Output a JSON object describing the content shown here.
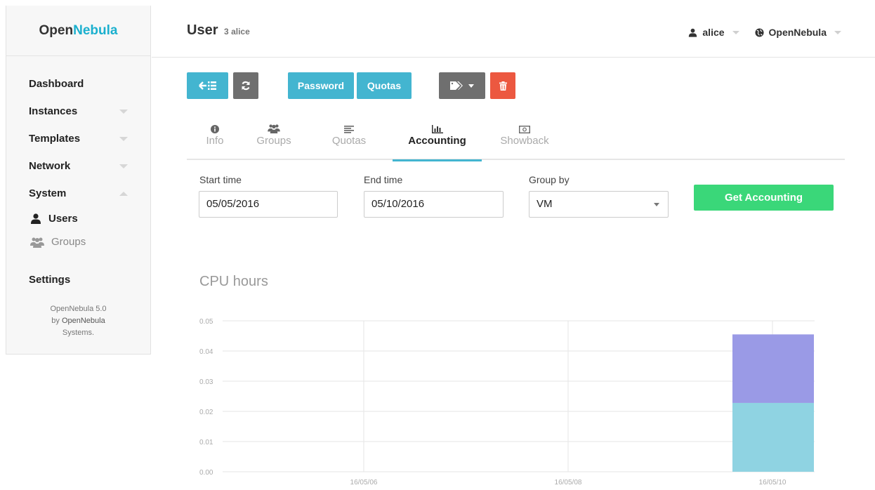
{
  "sidebar": {
    "logo_prefix": "Open",
    "logo_accent": "Nebula",
    "menu": [
      {
        "label": "Dashboard"
      },
      {
        "label": "Instances"
      },
      {
        "label": "Templates"
      },
      {
        "label": "Network"
      },
      {
        "label": "System"
      }
    ],
    "system_children": [
      {
        "label": "Users",
        "icon": "user-icon"
      },
      {
        "label": "Groups",
        "icon": "users-icon"
      }
    ],
    "settings_label": "Settings",
    "footer": {
      "version": "OpenNebula 5.0",
      "by": "by",
      "company": "OpenNebula",
      "company_suffix": "Systems."
    }
  },
  "header": {
    "title": "User",
    "id": "3",
    "name": "alice",
    "user_menu_label": "alice",
    "zone_menu_label": "OpenNebula"
  },
  "toolbar": {
    "back_icon": "back-to-list-icon",
    "refresh_icon": "refresh-icon",
    "password_label": "Password",
    "quotas_label": "Quotas",
    "labels_icon": "tags-icon",
    "delete_icon": "trash-icon"
  },
  "tabs": [
    {
      "label": "Info",
      "icon": "info-icon"
    },
    {
      "label": "Groups",
      "icon": "users-icon"
    },
    {
      "label": "Quotas",
      "icon": "align-left-icon"
    },
    {
      "label": "Accounting",
      "icon": "bar-chart-icon",
      "active": true
    },
    {
      "label": "Showback",
      "icon": "money-icon"
    }
  ],
  "form": {
    "start_label": "Start time",
    "start_value": "05/05/2016",
    "end_label": "End time",
    "end_value": "05/10/2016",
    "group_label": "Group by",
    "group_value": "VM",
    "submit_label": "Get Accounting"
  },
  "chart_data": {
    "type": "bar",
    "title": "CPU hours",
    "x_ticks": [
      "16/05/06",
      "16/05/08",
      "16/05/10"
    ],
    "y_ticks": [
      "0.00",
      "0.01",
      "0.02",
      "0.03",
      "0.04",
      "0.05"
    ],
    "ylim": [
      0,
      0.05
    ],
    "stacked": true,
    "bar_x": "16/05/10",
    "series": [
      {
        "values": [
          0.0228
        ],
        "color": "#8fd3e2"
      },
      {
        "values": [
          0.0227
        ],
        "color": "#9a9ae6"
      }
    ],
    "grid": true
  }
}
